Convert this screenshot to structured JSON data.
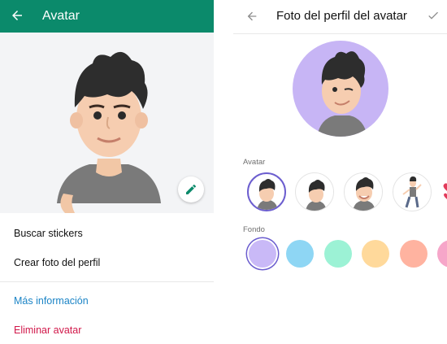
{
  "left": {
    "appbar": {
      "title": "Avatar",
      "back_icon": "arrow-left-icon"
    },
    "menu": {
      "buscar_stickers": "Buscar stickers",
      "crear_foto": "Crear foto del perfil",
      "mas_info": "Más información",
      "eliminar": "Eliminar avatar"
    }
  },
  "right": {
    "header": {
      "title": "Foto del perfil del avatar"
    },
    "avatar_section": {
      "label": "Avatar"
    },
    "fondo_section": {
      "label": "Fondo"
    },
    "background_colors": [
      "#c9b9f7",
      "#8ed6f4",
      "#9cf2d5",
      "#ffd99b",
      "#ffb3a0",
      "#f6a6c9"
    ]
  },
  "colors": {
    "accent": "#0b8a6b",
    "link": "#1b84c6",
    "danger": "#d1184a",
    "selection": "#6c5ecf"
  }
}
